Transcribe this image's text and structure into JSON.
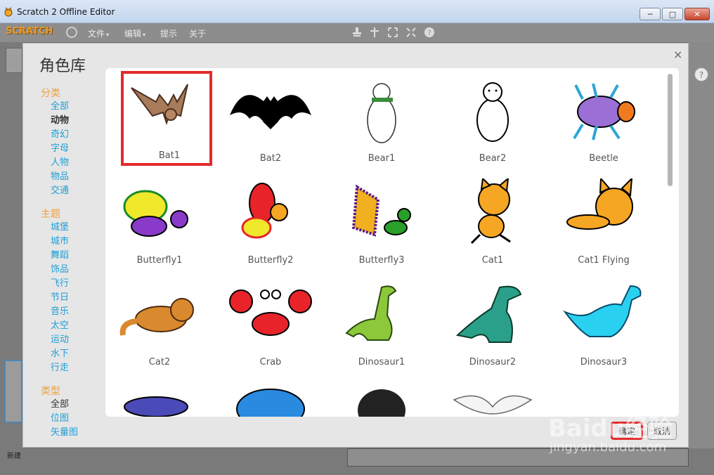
{
  "window": {
    "title": "Scratch 2 Offline Editor",
    "minimize_label": "─",
    "maximize_label": "□",
    "close_label": "✕"
  },
  "menubar": {
    "logo": "SCRATCH",
    "items": [
      {
        "label": "文件"
      },
      {
        "label": "编辑"
      },
      {
        "label": "提示"
      },
      {
        "label": "关于"
      }
    ],
    "caret": "▾"
  },
  "toolbar_icons": [
    "stamp-icon",
    "cut-icon",
    "grow-icon",
    "shrink-icon",
    "help-icon"
  ],
  "background": {
    "help_glyph": "?",
    "new_sprite_label": "新建"
  },
  "dialog": {
    "title": "角色库",
    "close_glyph": "×",
    "sections": [
      {
        "heading": "分类",
        "items": [
          {
            "label": "全部",
            "active": false
          },
          {
            "label": "动物",
            "active": true
          },
          {
            "label": "奇幻",
            "active": false
          },
          {
            "label": "字母",
            "active": false
          },
          {
            "label": "人物",
            "active": false
          },
          {
            "label": "物品",
            "active": false
          },
          {
            "label": "交通",
            "active": false
          }
        ]
      },
      {
        "heading": "主题",
        "items": [
          {
            "label": "城堡",
            "active": false
          },
          {
            "label": "城市",
            "active": false
          },
          {
            "label": "舞蹈",
            "active": false
          },
          {
            "label": "饰品",
            "active": false
          },
          {
            "label": "飞行",
            "active": false
          },
          {
            "label": "节日",
            "active": false
          },
          {
            "label": "音乐",
            "active": false
          },
          {
            "label": "太空",
            "active": false
          },
          {
            "label": "运动",
            "active": false
          },
          {
            "label": "水下",
            "active": false
          },
          {
            "label": "行走",
            "active": false
          }
        ]
      },
      {
        "heading": "类型",
        "items": [
          {
            "label": "全部",
            "active": true
          },
          {
            "label": "位图",
            "active": false
          },
          {
            "label": "矢量图",
            "active": false
          }
        ]
      }
    ],
    "sprites": [
      {
        "name": "Bat1",
        "icon": "brown-bat",
        "selected": true
      },
      {
        "name": "Bat2",
        "icon": "black-bat",
        "selected": false
      },
      {
        "name": "Bear1",
        "icon": "polar-bear-scarf",
        "selected": false
      },
      {
        "name": "Bear2",
        "icon": "bear-outline",
        "selected": false
      },
      {
        "name": "Beetle",
        "icon": "beetle",
        "selected": false
      },
      {
        "name": "Butterfly1",
        "icon": "butterfly-green",
        "selected": false
      },
      {
        "name": "Butterfly2",
        "icon": "butterfly-red",
        "selected": false
      },
      {
        "name": "Butterfly3",
        "icon": "butterfly-purple",
        "selected": false
      },
      {
        "name": "Cat1",
        "icon": "cat-walking",
        "selected": false
      },
      {
        "name": "Cat1 Flying",
        "icon": "cat-flying",
        "selected": false
      },
      {
        "name": "Cat2",
        "icon": "cat-lying",
        "selected": false
      },
      {
        "name": "Crab",
        "icon": "crab",
        "selected": false
      },
      {
        "name": "Dinosaur1",
        "icon": "dinosaur-green",
        "selected": false
      },
      {
        "name": "Dinosaur2",
        "icon": "dinosaur-teal",
        "selected": false
      },
      {
        "name": "Dinosaur3",
        "icon": "dinosaur-blue",
        "selected": false
      },
      {
        "name": "",
        "icon": "dog-purple",
        "selected": false
      },
      {
        "name": "",
        "icon": "dog-blue",
        "selected": false
      },
      {
        "name": "",
        "icon": "dog-black",
        "selected": false
      },
      {
        "name": "",
        "icon": "dove",
        "selected": false
      }
    ],
    "ok_label": "确定",
    "cancel_label": "取消"
  },
  "watermark": {
    "big": "Baidu经验",
    "small": "jingyan.baidu.com"
  },
  "colors": {
    "category_heading": "#f0a03c",
    "category_link": "#1f9fd7",
    "selection": "#e32b2b"
  }
}
